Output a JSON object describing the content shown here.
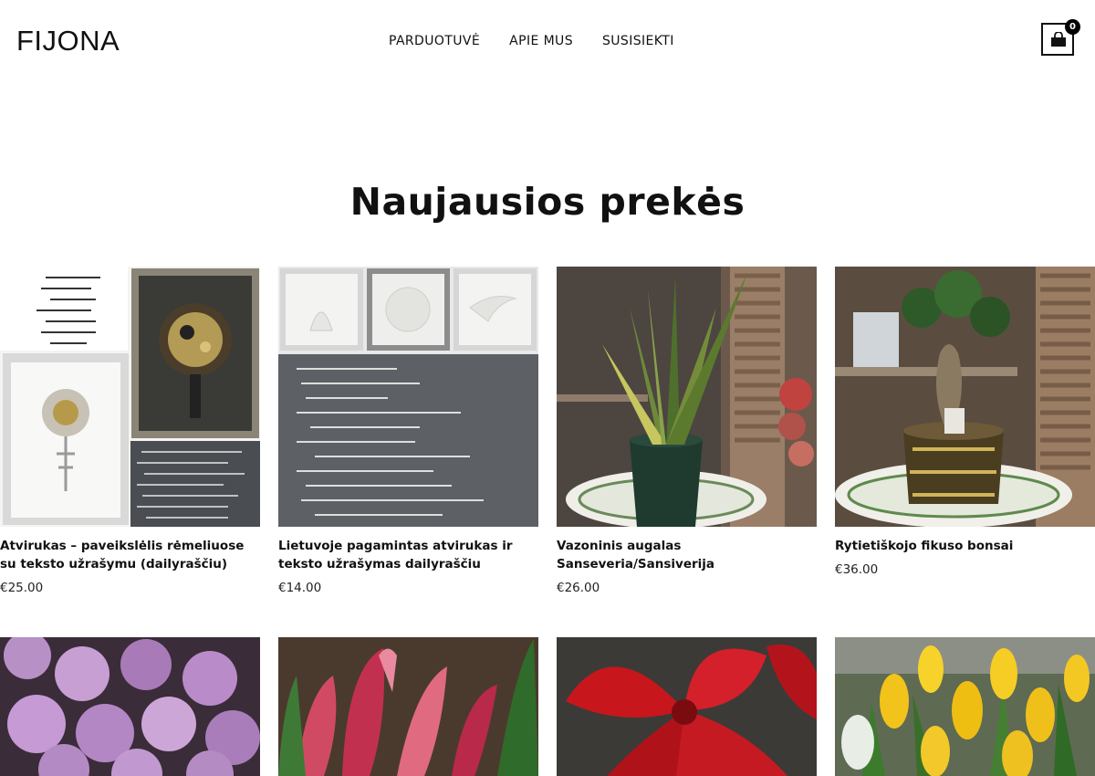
{
  "header": {
    "logo": "FIJONA",
    "nav": [
      "PARDUOTUVĖ",
      "APIE MUS",
      "SUSISIEKTI"
    ],
    "cart_count": "0"
  },
  "section": {
    "title": "Naujausios prekės"
  },
  "products": [
    {
      "name": "Atvirukas – paveikslėlis rėmeliuose su teksto užrašymu (dailyraščiu)",
      "price": "€25.00",
      "image": "framed-card-collage"
    },
    {
      "name": "Lietuvoje pagamintas atvirukas ir teksto užrašymas dailyraščiu",
      "price": "€14.00",
      "image": "embossed-card-calligraphy"
    },
    {
      "name": "Vazoninis augalas Sanseveria/Sansiverija",
      "price": "€26.00",
      "image": "snake-plant-pot"
    },
    {
      "name": "Rytietiškojo fikuso bonsai",
      "price": "€36.00",
      "image": "ficus-bonsai-pot"
    }
  ],
  "products_row2": [
    {
      "image": "purple-roses"
    },
    {
      "image": "pink-protea"
    },
    {
      "image": "red-amaryllis"
    },
    {
      "image": "yellow-tulips"
    }
  ]
}
